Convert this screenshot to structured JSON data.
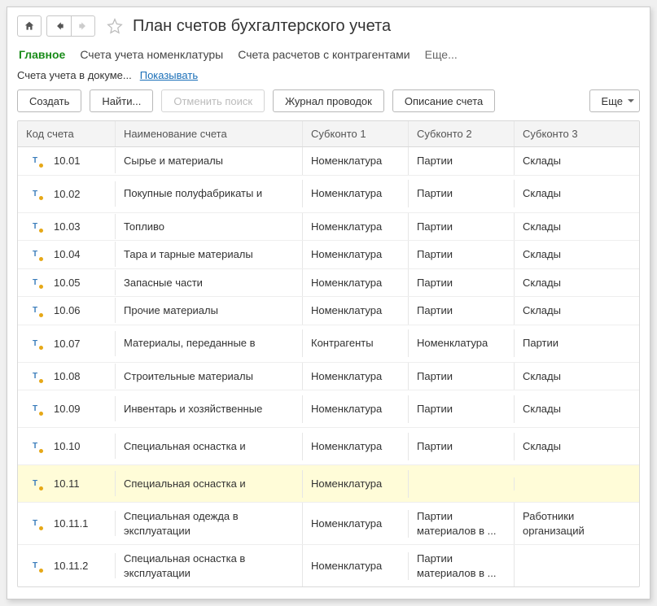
{
  "header": {
    "title": "План счетов бухгалтерского учета"
  },
  "tabs": {
    "main": "Главное",
    "nomenclature": "Счета учета номенклатуры",
    "contractors": "Счета расчетов с контрагентами",
    "more": "Еще..."
  },
  "subrow": {
    "label": "Счета учета в докуме...",
    "link": "Показывать"
  },
  "toolbar": {
    "create": "Создать",
    "find": "Найти...",
    "cancel_search": "Отменить поиск",
    "journal": "Журнал проводок",
    "description": "Описание счета",
    "more": "Еще"
  },
  "columns": {
    "code": "Код счета",
    "name": "Наименование счета",
    "s1": "Субконто 1",
    "s2": "Субконто 2",
    "s3": "Субконто 3"
  },
  "rows": [
    {
      "code": "10.01",
      "name": "Сырье и материалы",
      "s1": "Номенклатура",
      "s2": "Партии",
      "s3": "Склады"
    },
    {
      "code": "10.02",
      "name": "Покупные полуфабрикаты и",
      "s1": "Номенклатура",
      "s2": "Партии",
      "s3": "Склады",
      "tall": true
    },
    {
      "code": "10.03",
      "name": "Топливо",
      "s1": "Номенклатура",
      "s2": "Партии",
      "s3": "Склады"
    },
    {
      "code": "10.04",
      "name": "Тара и тарные материалы",
      "s1": "Номенклатура",
      "s2": "Партии",
      "s3": "Склады"
    },
    {
      "code": "10.05",
      "name": "Запасные части",
      "s1": "Номенклатура",
      "s2": "Партии",
      "s3": "Склады"
    },
    {
      "code": "10.06",
      "name": "Прочие материалы",
      "s1": "Номенклатура",
      "s2": "Партии",
      "s3": "Склады"
    },
    {
      "code": "10.07",
      "name": "Материалы, переданные в",
      "s1": "Контрагенты",
      "s2": "Номенклатура",
      "s3": "Партии",
      "tall": true
    },
    {
      "code": "10.08",
      "name": "Строительные материалы",
      "s1": "Номенклатура",
      "s2": "Партии",
      "s3": "Склады"
    },
    {
      "code": "10.09",
      "name": "Инвентарь и хозяйственные",
      "s1": "Номенклатура",
      "s2": "Партии",
      "s3": "Склады",
      "tall": true
    },
    {
      "code": "10.10",
      "name": "Специальная оснастка и",
      "s1": "Номенклатура",
      "s2": "Партии",
      "s3": "Склады",
      "tall": true
    },
    {
      "code": "10.11",
      "name": "Специальная оснастка и",
      "s1": "Номенклатура",
      "s2": "",
      "s3": "",
      "tall": true,
      "selected": true
    },
    {
      "code": "10.11.1",
      "name": "Специальная одежда в эксплуатации",
      "s1": "Номенклатура",
      "s2": "Партии материалов в ...",
      "s3": "Работники организаций",
      "tall": true
    },
    {
      "code": "10.11.2",
      "name": "Специальная оснастка в эксплуатации",
      "s1": "Номенклатура",
      "s2": "Партии материалов в ...",
      "s3": "",
      "tall": true
    }
  ]
}
